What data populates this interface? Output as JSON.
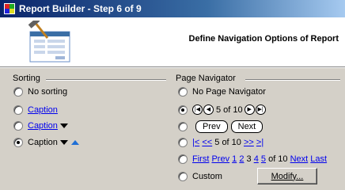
{
  "window": {
    "title": "Report Builder - Step 6 of 9"
  },
  "header": {
    "title": "Define Navigation Options of Report"
  },
  "sorting": {
    "label": "Sorting",
    "options": [
      {
        "label": "No sorting",
        "style": "text",
        "checked": false
      },
      {
        "label": "Caption",
        "style": "link",
        "checked": false
      },
      {
        "label": "Caption",
        "style": "link-arrow",
        "checked": false
      },
      {
        "label": "Caption",
        "style": "text-arrows",
        "checked": true
      }
    ]
  },
  "navigator": {
    "label": "Page Navigator",
    "no_navigator": "No Page Navigator",
    "icons_text": "5 of 10",
    "prev_label": "Prev",
    "next_label": "Next",
    "text_nav": {
      "first": "|<",
      "prev": "<<",
      "middle": "5 of 10",
      "next": ">>",
      "last": ">|"
    },
    "links_nav": {
      "first": "First",
      "prev": "Prev",
      "pages": [
        "1",
        "2"
      ],
      "current": "3",
      "pages_after": [
        "4",
        "5"
      ],
      "of_text": "of 10",
      "next": "Next",
      "last": "Last"
    },
    "custom_label": "Custom",
    "modify_label": "Modify...",
    "selected": "icons"
  }
}
